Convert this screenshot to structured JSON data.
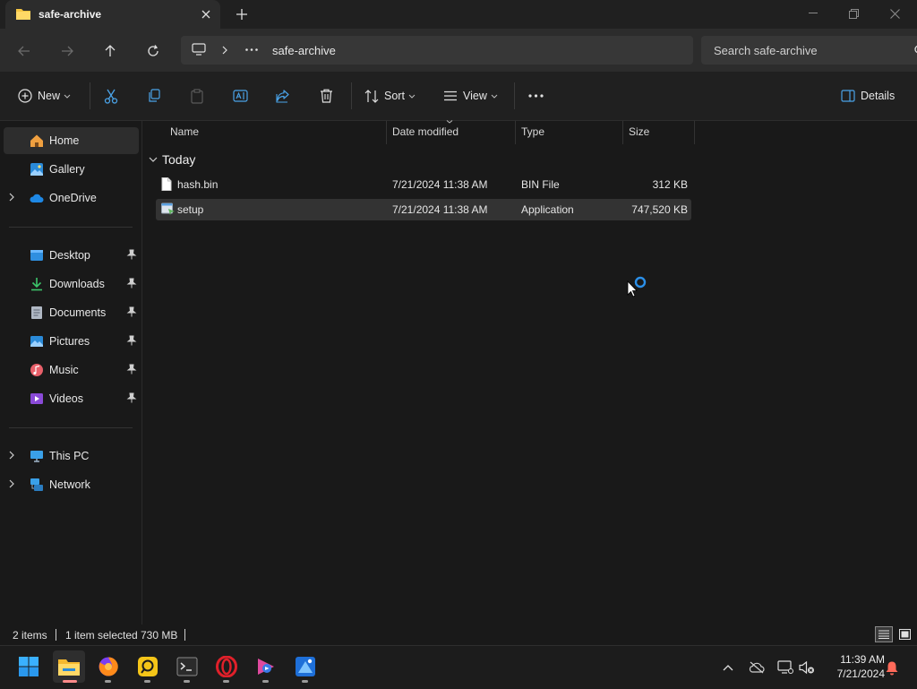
{
  "window": {
    "tab_title": "safe-archive"
  },
  "nav": {
    "address_location": "safe-archive",
    "search_placeholder": "Search safe-archive"
  },
  "commands": {
    "new_label": "New",
    "sort_label": "Sort",
    "view_label": "View",
    "details_label": "Details"
  },
  "sidebar": {
    "home": "Home",
    "gallery": "Gallery",
    "onedrive": "OneDrive",
    "desktop": "Desktop",
    "downloads": "Downloads",
    "documents": "Documents",
    "pictures": "Pictures",
    "music": "Music",
    "videos": "Videos",
    "this_pc": "This PC",
    "network": "Network"
  },
  "columns": {
    "name": "Name",
    "date_modified": "Date modified",
    "type": "Type",
    "size": "Size"
  },
  "group": {
    "label": "Today"
  },
  "files": [
    {
      "name": "hash.bin",
      "date": "7/21/2024 11:38 AM",
      "type": "BIN File",
      "size": "312 KB"
    },
    {
      "name": "setup",
      "date": "7/21/2024 11:38 AM",
      "type": "Application",
      "size": "747,520 KB"
    }
  ],
  "status": {
    "item_count": "2 items",
    "selection": "1 item selected",
    "selection_size": "730 MB"
  },
  "taskbar": {
    "time": "11:39 AM",
    "date": "7/21/2024"
  },
  "colors": {
    "accent": "#0078d4",
    "folder": "#f5c542",
    "background": "#191919"
  }
}
